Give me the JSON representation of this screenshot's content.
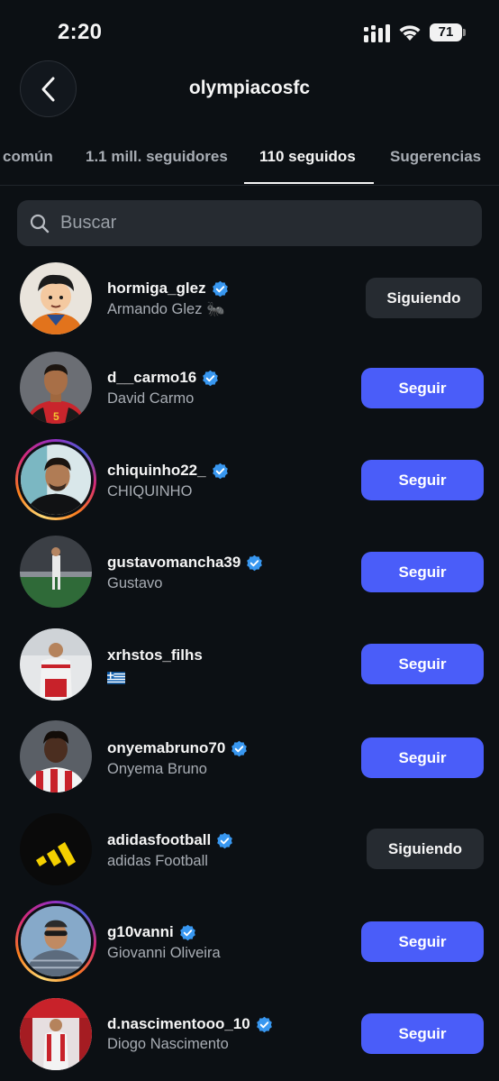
{
  "status_bar": {
    "time": "2:20",
    "battery": "71"
  },
  "header": {
    "title": "olympiacosfc"
  },
  "tabs": [
    {
      "label": "común"
    },
    {
      "label": "1.1 mill. seguidores"
    },
    {
      "label": "110 seguidos"
    },
    {
      "label": "Sugerencias"
    }
  ],
  "search": {
    "placeholder": "Buscar"
  },
  "accounts": [
    {
      "username": "hormiga_glez",
      "full_name": "Armando Glez 🐜",
      "button": "Siguiendo"
    },
    {
      "username": "d__carmo16",
      "full_name": "David Carmo",
      "button": "Seguir"
    },
    {
      "username": "chiquinho22_",
      "full_name": "CHIQUINHO",
      "button": "Seguir"
    },
    {
      "username": "gustavomancha39",
      "full_name": "Gustavo",
      "button": "Seguir"
    },
    {
      "username": "xrhstos_filhs",
      "full_name": "",
      "button": "Seguir"
    },
    {
      "username": "onyemabruno70",
      "full_name": "Onyema Bruno",
      "button": "Seguir"
    },
    {
      "username": "adidasfootball",
      "full_name": "adidas Football",
      "button": "Siguiendo"
    },
    {
      "username": "g10vanni",
      "full_name": "Giovanni Oliveira",
      "button": "Seguir"
    },
    {
      "username": "d.nascimentooo_10",
      "full_name": "Diogo Nascimento",
      "button": "Seguir"
    }
  ],
  "colors": {
    "follow_button": "#4a5df9",
    "following_button": "#262b31",
    "verified_badge": "#3897f0",
    "background": "#0c1014"
  },
  "icons": {
    "back": "chevron-left-icon",
    "search": "search-icon",
    "verified": "verified-badge-icon"
  }
}
